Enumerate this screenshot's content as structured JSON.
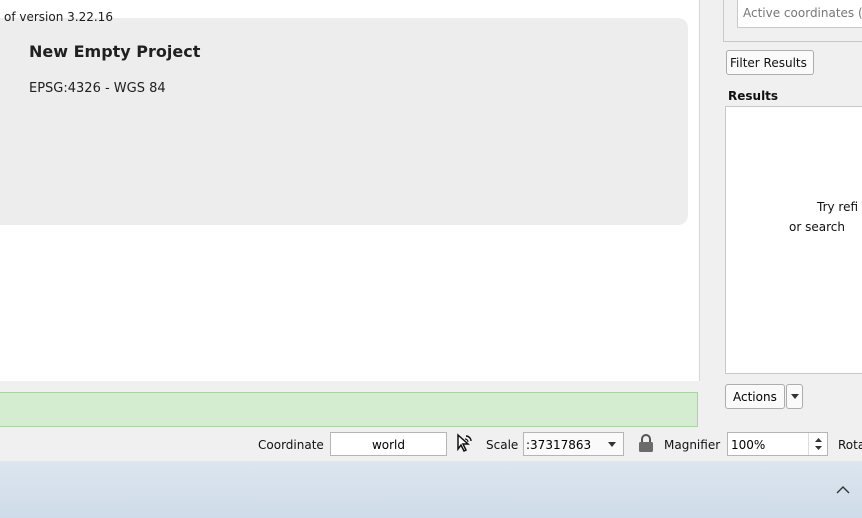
{
  "project": {
    "title": "New Empty Project",
    "crs": "EPSG:4326 - WGS 84"
  },
  "message_bar": {
    "text": "of version 3.22.16"
  },
  "right_panel": {
    "coord_placeholder": "Active coordinates (",
    "filter_button": "Filter Results",
    "results_label": "Results",
    "hint_line1": "Try refi",
    "hint_line2": "or search",
    "actions_button": "Actions"
  },
  "status_bar": {
    "coordinate_label": "Coordinate",
    "coordinate_value": "world",
    "scale_label": "Scale",
    "scale_value": ":37317863",
    "magnifier_label": "Magnifier",
    "magnifier_value": "100%",
    "rotation_label": "Rota"
  },
  "icons": {
    "mouse": "mouse-pointer-icon",
    "lock": "lock-icon",
    "chevron": "chevron-up-icon"
  },
  "colors": {
    "message_bar_bg": "#d4ecd0",
    "project_card_bg": "#ededed"
  }
}
